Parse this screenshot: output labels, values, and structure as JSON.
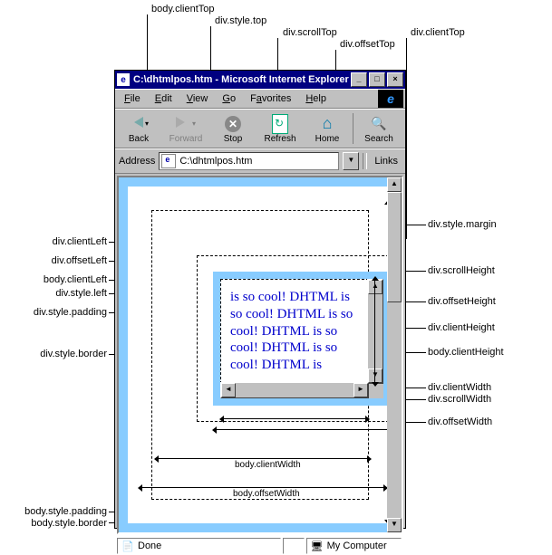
{
  "callouts": {
    "top": {
      "body_clientTop": "body.clientTop",
      "div_style_top": "div.style.top",
      "div_scrollTop": "div.scrollTop",
      "div_offsetTop": "div.offsetTop",
      "div_clientTop": "div.clientTop"
    },
    "left": {
      "div_clientLeft": "div.clientLeft",
      "div_offsetLeft": "div.offsetLeft",
      "body_clientLeft": "body.clientLeft",
      "div_style_left": "div.style.left",
      "div_style_padding": "div.style.padding",
      "div_style_border": "div.style.border",
      "body_style_padding": "body.style.padding",
      "body_style_border": "body.style.border"
    },
    "right": {
      "div_style_margin": "div.style.margin",
      "div_scrollHeight": "div.scrollHeight",
      "div_offsetHeight": "div.offsetHeight",
      "div_clientHeight": "div.clientHeight",
      "body_clientHeight": "body.clientHeight",
      "div_clientWidth": "div.clientWidth",
      "div_scrollWidth": "div.scrollWidth",
      "div_offsetWidth": "div.offsetWidth"
    }
  },
  "window": {
    "title": "C:\\dhtmlpos.htm - Microsoft Internet Explorer",
    "menu": {
      "file": "File",
      "edit": "Edit",
      "view": "View",
      "go": "Go",
      "favorites": "Favorites",
      "help": "Help"
    },
    "toolbar": {
      "back": "Back",
      "forward": "Forward",
      "stop": "Stop",
      "refresh": "Refresh",
      "home": "Home",
      "search": "Search"
    },
    "address_label": "Address",
    "address_value": "C:\\dhtmlpos.htm",
    "links_label": "Links",
    "status_done": "Done",
    "status_zone": "My Computer"
  },
  "div_content": "is so cool! DHTML is so cool! DHTML is so cool! DHTML is so cool! DHTML is so cool! DHTML is",
  "dim_labels": {
    "body_clientWidth": "body.clientWidth",
    "body_offsetWidth": "body.offsetWidth"
  }
}
